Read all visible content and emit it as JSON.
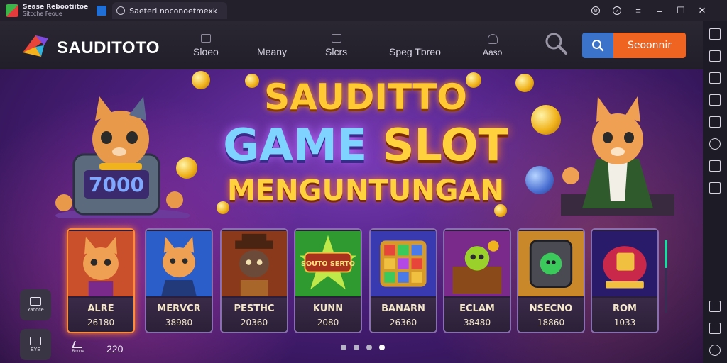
{
  "window": {
    "app_title_line1": "Sease Rebootiitoe",
    "app_title_line2": "Sitcche Feoue",
    "tab_label": "Saeteri noconoetmexk",
    "controls": [
      "settings-icon",
      "help-icon",
      "menu-icon",
      "minimize-icon",
      "maximize-icon",
      "close-icon"
    ]
  },
  "nav": {
    "brand": "SAUDITOTO",
    "items": [
      {
        "label": "Sloeo",
        "icon": "slot-icon"
      },
      {
        "label": "Meany",
        "icon": ""
      },
      {
        "label": "Slcrs",
        "icon": "list-icon"
      },
      {
        "label": "Speg Tbreo",
        "icon": ""
      },
      {
        "label": "Aaso",
        "icon": "person-icon"
      }
    ],
    "search_cta": "Seoonnir"
  },
  "hero": {
    "line1": "SAUDITTO",
    "line2_game": "GAME",
    "line2_slot": "SLOT",
    "line3": "MENGUNTUNGAN",
    "slot_machine_value": "7000"
  },
  "cards": [
    {
      "name": "ALRE",
      "value": "26180",
      "active": true
    },
    {
      "name": "MERVCR",
      "value": "38980",
      "active": false
    },
    {
      "name": "PESTHC",
      "value": "20360",
      "active": false
    },
    {
      "name": "KUNN",
      "value": "2080",
      "active": false
    },
    {
      "name": "BANARN",
      "value": "26360",
      "active": false
    },
    {
      "name": "ECLAM",
      "value": "38480",
      "active": false
    },
    {
      "name": "NSECNO",
      "value": "18860",
      "active": false
    },
    {
      "name": "ROM",
      "value": "1033",
      "active": false
    }
  ],
  "card_art_labels": {
    "kunn": "SOUTO SERTO"
  },
  "float_buttons": [
    {
      "label": "Yaooce",
      "icon": "chat-icon"
    },
    {
      "label": "EYE",
      "icon": "gamepad-icon"
    }
  ],
  "bottom": {
    "icon_label": "Boone",
    "count": "220"
  },
  "pagination": {
    "total": 4,
    "active_index": 3
  },
  "colors": {
    "accent_orange": "#ee6420",
    "search_blue": "#3a73c9",
    "hero_purple": "#4b1f7d",
    "title_gold": "#ffc933"
  }
}
